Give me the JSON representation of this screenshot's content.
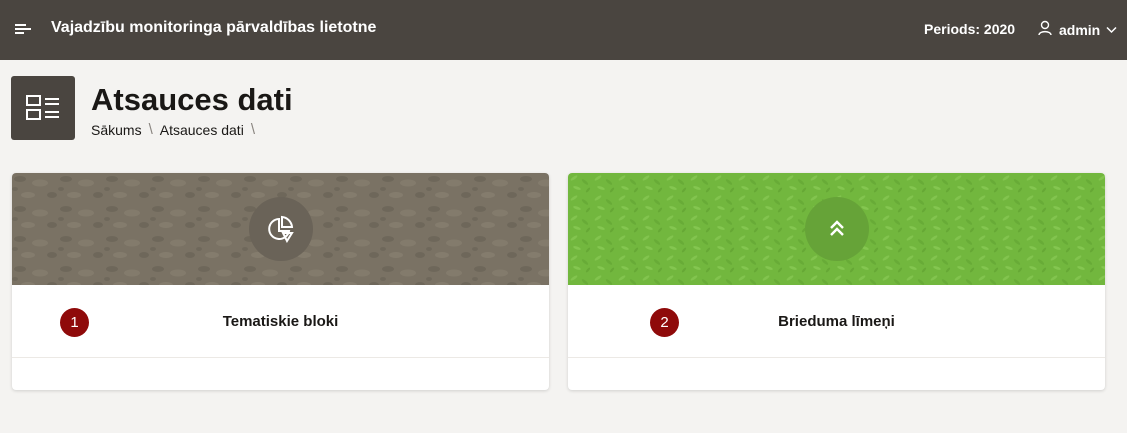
{
  "header": {
    "app_title": "Vajadzību monitoringa pārvaldības lietotne",
    "period_label": "Periods: 2020",
    "user_name": "admin",
    "menu_icon": "hamburger-icon",
    "user_icon": "user-icon",
    "dropdown_icon": "chevron-down-icon"
  },
  "page": {
    "title": "Atsauces dati",
    "icon": "list-layout-icon",
    "breadcrumb": [
      {
        "label": "Sākums"
      },
      {
        "label": "Atsauces dati"
      }
    ]
  },
  "cards": [
    {
      "badge": "1",
      "title": "Tematiskie bloki",
      "icon": "pie-chart-icon",
      "banner_color": "#7a7264"
    },
    {
      "badge": "2",
      "title": "Brieduma līmeņi",
      "icon": "double-chevron-up-icon",
      "banner_color": "#72b73e"
    }
  ],
  "colors": {
    "header_bg": "#4a4540",
    "page_bg": "#f4f3f1",
    "badge_bg": "#8f0a0a"
  }
}
